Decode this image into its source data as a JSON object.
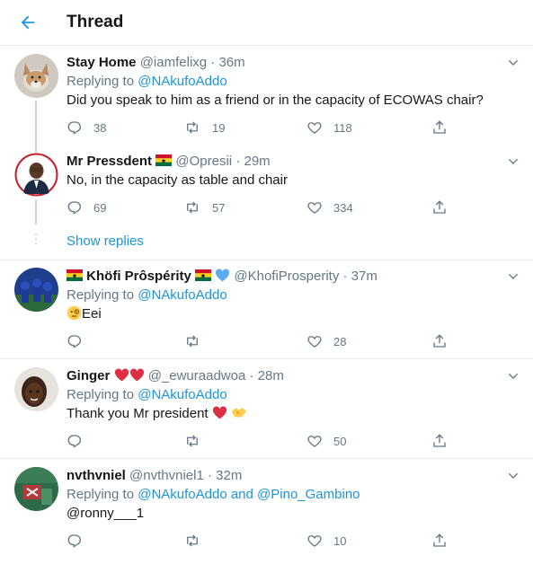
{
  "header": {
    "title": "Thread",
    "back_icon": "arrow-left-icon"
  },
  "colors": {
    "accent": "#1b95e0",
    "text": "#14171a",
    "muted": "#657786",
    "heart": "#e0245e",
    "line": "#e6ecf0"
  },
  "show_replies_label": "Show replies",
  "tweets": [
    {
      "name": "Stay Home",
      "handle": "@iamfelixg",
      "time": "36m",
      "replying_prefix": "Replying to",
      "replying_to": "@NAkufoAddo",
      "text": "Did you speak to him as a friend or in the capacity of ECOWAS chair?",
      "replies": "38",
      "retweets": "19",
      "likes": "118"
    },
    {
      "name": "Mr Pressdent",
      "handle": "@Opresii",
      "time": "29m",
      "text": "No, in the capacity as table and chair",
      "replies": "69",
      "retweets": "57",
      "likes": "334"
    },
    {
      "name": "Khöfi Prôspérity",
      "handle": "@KhofiProsperity",
      "time": "37m",
      "replying_prefix": "Replying to",
      "replying_to": "@NAkufoAddo",
      "text": "Eei",
      "replies": "",
      "retweets": "",
      "likes": "28"
    },
    {
      "name": "Ginger",
      "handle": "@_ewuraadwoa",
      "time": "28m",
      "replying_prefix": "Replying to",
      "replying_to": "@NAkufoAddo",
      "text": "Thank you Mr president",
      "replies": "",
      "retweets": "",
      "likes": "50"
    },
    {
      "name": "nvthvniel",
      "handle": "@nvthvniel1",
      "time": "32m",
      "replying_prefix": "Replying to",
      "replying_to": "@NAkufoAddo",
      "replying_and": "and",
      "replying_to_2": "@Pino_Gambino",
      "text": "@ronny___1",
      "replies": "",
      "retweets": "",
      "likes": "10"
    }
  ]
}
